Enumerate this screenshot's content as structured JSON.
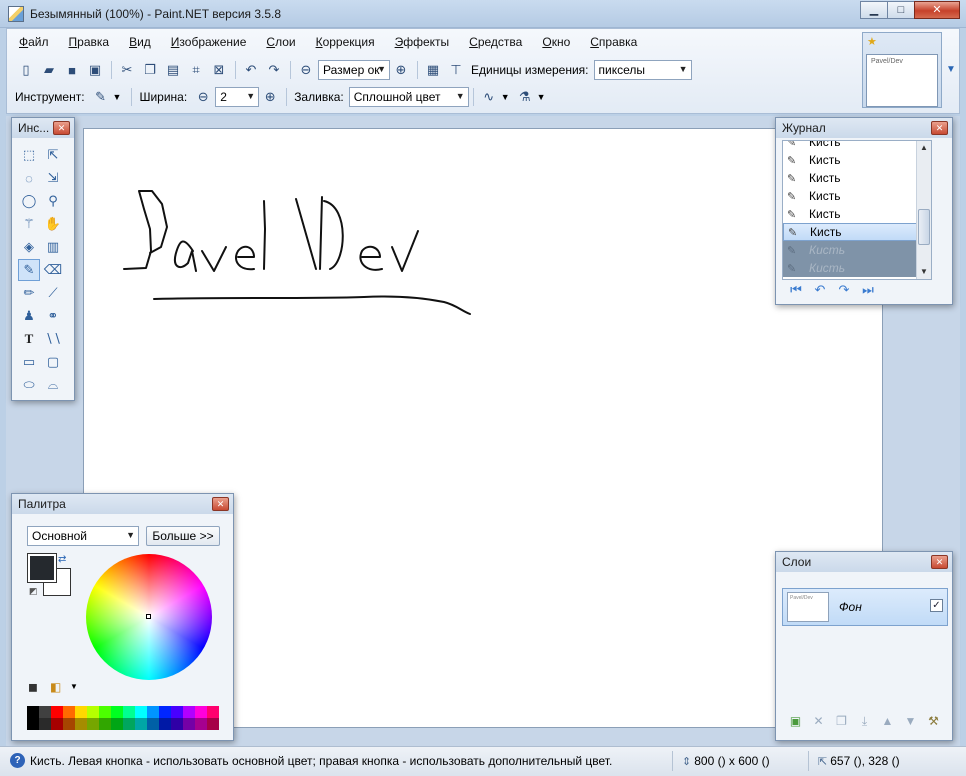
{
  "window": {
    "title": "Безымянный (100%) - Paint.NET версия 3.5.8",
    "controls": {
      "minimize": "▁",
      "maximize": "□",
      "close": "✕"
    }
  },
  "menu": [
    "Файл",
    "Правка",
    "Вид",
    "Изображение",
    "Слои",
    "Коррекция",
    "Эффекты",
    "Средства",
    "Окно",
    "Справка"
  ],
  "toolbar": {
    "zoom_combo": "Размер ок",
    "units_label": "Единицы измерения:",
    "units_value": "пикселы",
    "tool_label": "Инструмент:",
    "width_label": "Ширина:",
    "width_value": "2",
    "fill_label": "Заливка:",
    "fill_value": "Сплошной цвет"
  },
  "thumbnail": {
    "caption": "Pavel/Dev"
  },
  "canvas": {
    "drawn_text": "Pavel/Dev"
  },
  "tools_window": {
    "title": "Инс..."
  },
  "history_window": {
    "title": "Журнал",
    "items": [
      {
        "label": "Кисть",
        "state": "done"
      },
      {
        "label": "Кисть",
        "state": "done"
      },
      {
        "label": "Кисть",
        "state": "done"
      },
      {
        "label": "Кисть",
        "state": "done"
      },
      {
        "label": "Кисть",
        "state": "done"
      },
      {
        "label": "Кисть",
        "state": "selected"
      },
      {
        "label": "Кисть",
        "state": "redo"
      },
      {
        "label": "Кисть",
        "state": "redo"
      }
    ]
  },
  "palette_window": {
    "title": "Палитра",
    "mode_select": "Основной",
    "more_button": "Больше >>",
    "primary_color": "#25292e",
    "secondary_color": "#ffffff",
    "swatches": [
      "#000000",
      "#404040",
      "#ff0000",
      "#ff6a00",
      "#ffd800",
      "#b6ff00",
      "#4cff00",
      "#00ff21",
      "#00ff90",
      "#00ffff",
      "#0094ff",
      "#0026ff",
      "#4800ff",
      "#b200ff",
      "#ff00dc",
      "#ff006e"
    ]
  },
  "layers_window": {
    "title": "Слои",
    "layers": [
      {
        "name": "Фон",
        "visible": true
      }
    ]
  },
  "statusbar": {
    "help": "Кисть. Левая кнопка - использовать основной цвет; правая кнопка - использовать дополнительный цвет.",
    "image_size": "800 () x 600 ()",
    "cursor_pos": "657 (), 328 ()"
  }
}
